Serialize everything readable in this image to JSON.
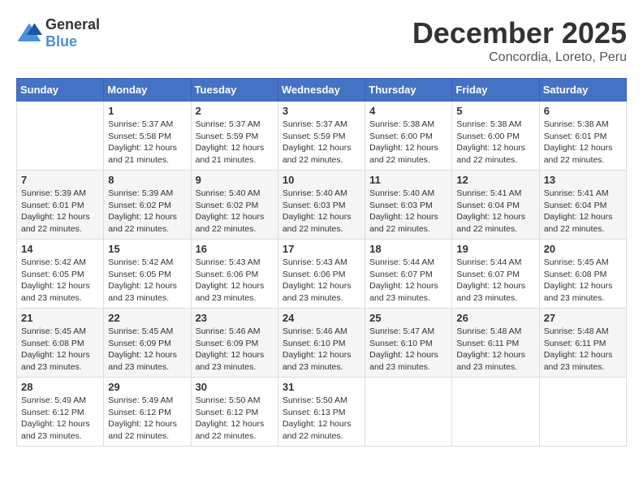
{
  "logo": {
    "general": "General",
    "blue": "Blue"
  },
  "title": {
    "month": "December 2025",
    "location": "Concordia, Loreto, Peru"
  },
  "weekdays": [
    "Sunday",
    "Monday",
    "Tuesday",
    "Wednesday",
    "Thursday",
    "Friday",
    "Saturday"
  ],
  "weeks": [
    [
      {
        "day": "",
        "info": ""
      },
      {
        "day": "1",
        "info": "Sunrise: 5:37 AM\nSunset: 5:58 PM\nDaylight: 12 hours\nand 21 minutes."
      },
      {
        "day": "2",
        "info": "Sunrise: 5:37 AM\nSunset: 5:59 PM\nDaylight: 12 hours\nand 21 minutes."
      },
      {
        "day": "3",
        "info": "Sunrise: 5:37 AM\nSunset: 5:59 PM\nDaylight: 12 hours\nand 22 minutes."
      },
      {
        "day": "4",
        "info": "Sunrise: 5:38 AM\nSunset: 6:00 PM\nDaylight: 12 hours\nand 22 minutes."
      },
      {
        "day": "5",
        "info": "Sunrise: 5:38 AM\nSunset: 6:00 PM\nDaylight: 12 hours\nand 22 minutes."
      },
      {
        "day": "6",
        "info": "Sunrise: 5:38 AM\nSunset: 6:01 PM\nDaylight: 12 hours\nand 22 minutes."
      }
    ],
    [
      {
        "day": "7",
        "info": "Sunrise: 5:39 AM\nSunset: 6:01 PM\nDaylight: 12 hours\nand 22 minutes."
      },
      {
        "day": "8",
        "info": "Sunrise: 5:39 AM\nSunset: 6:02 PM\nDaylight: 12 hours\nand 22 minutes."
      },
      {
        "day": "9",
        "info": "Sunrise: 5:40 AM\nSunset: 6:02 PM\nDaylight: 12 hours\nand 22 minutes."
      },
      {
        "day": "10",
        "info": "Sunrise: 5:40 AM\nSunset: 6:03 PM\nDaylight: 12 hours\nand 22 minutes."
      },
      {
        "day": "11",
        "info": "Sunrise: 5:40 AM\nSunset: 6:03 PM\nDaylight: 12 hours\nand 22 minutes."
      },
      {
        "day": "12",
        "info": "Sunrise: 5:41 AM\nSunset: 6:04 PM\nDaylight: 12 hours\nand 22 minutes."
      },
      {
        "day": "13",
        "info": "Sunrise: 5:41 AM\nSunset: 6:04 PM\nDaylight: 12 hours\nand 22 minutes."
      }
    ],
    [
      {
        "day": "14",
        "info": "Sunrise: 5:42 AM\nSunset: 6:05 PM\nDaylight: 12 hours\nand 23 minutes."
      },
      {
        "day": "15",
        "info": "Sunrise: 5:42 AM\nSunset: 6:05 PM\nDaylight: 12 hours\nand 23 minutes."
      },
      {
        "day": "16",
        "info": "Sunrise: 5:43 AM\nSunset: 6:06 PM\nDaylight: 12 hours\nand 23 minutes."
      },
      {
        "day": "17",
        "info": "Sunrise: 5:43 AM\nSunset: 6:06 PM\nDaylight: 12 hours\nand 23 minutes."
      },
      {
        "day": "18",
        "info": "Sunrise: 5:44 AM\nSunset: 6:07 PM\nDaylight: 12 hours\nand 23 minutes."
      },
      {
        "day": "19",
        "info": "Sunrise: 5:44 AM\nSunset: 6:07 PM\nDaylight: 12 hours\nand 23 minutes."
      },
      {
        "day": "20",
        "info": "Sunrise: 5:45 AM\nSunset: 6:08 PM\nDaylight: 12 hours\nand 23 minutes."
      }
    ],
    [
      {
        "day": "21",
        "info": "Sunrise: 5:45 AM\nSunset: 6:08 PM\nDaylight: 12 hours\nand 23 minutes."
      },
      {
        "day": "22",
        "info": "Sunrise: 5:45 AM\nSunset: 6:09 PM\nDaylight: 12 hours\nand 23 minutes."
      },
      {
        "day": "23",
        "info": "Sunrise: 5:46 AM\nSunset: 6:09 PM\nDaylight: 12 hours\nand 23 minutes."
      },
      {
        "day": "24",
        "info": "Sunrise: 5:46 AM\nSunset: 6:10 PM\nDaylight: 12 hours\nand 23 minutes."
      },
      {
        "day": "25",
        "info": "Sunrise: 5:47 AM\nSunset: 6:10 PM\nDaylight: 12 hours\nand 23 minutes."
      },
      {
        "day": "26",
        "info": "Sunrise: 5:48 AM\nSunset: 6:11 PM\nDaylight: 12 hours\nand 23 minutes."
      },
      {
        "day": "27",
        "info": "Sunrise: 5:48 AM\nSunset: 6:11 PM\nDaylight: 12 hours\nand 23 minutes."
      }
    ],
    [
      {
        "day": "28",
        "info": "Sunrise: 5:49 AM\nSunset: 6:12 PM\nDaylight: 12 hours\nand 23 minutes."
      },
      {
        "day": "29",
        "info": "Sunrise: 5:49 AM\nSunset: 6:12 PM\nDaylight: 12 hours\nand 22 minutes."
      },
      {
        "day": "30",
        "info": "Sunrise: 5:50 AM\nSunset: 6:12 PM\nDaylight: 12 hours\nand 22 minutes."
      },
      {
        "day": "31",
        "info": "Sunrise: 5:50 AM\nSunset: 6:13 PM\nDaylight: 12 hours\nand 22 minutes."
      },
      {
        "day": "",
        "info": ""
      },
      {
        "day": "",
        "info": ""
      },
      {
        "day": "",
        "info": ""
      }
    ]
  ]
}
